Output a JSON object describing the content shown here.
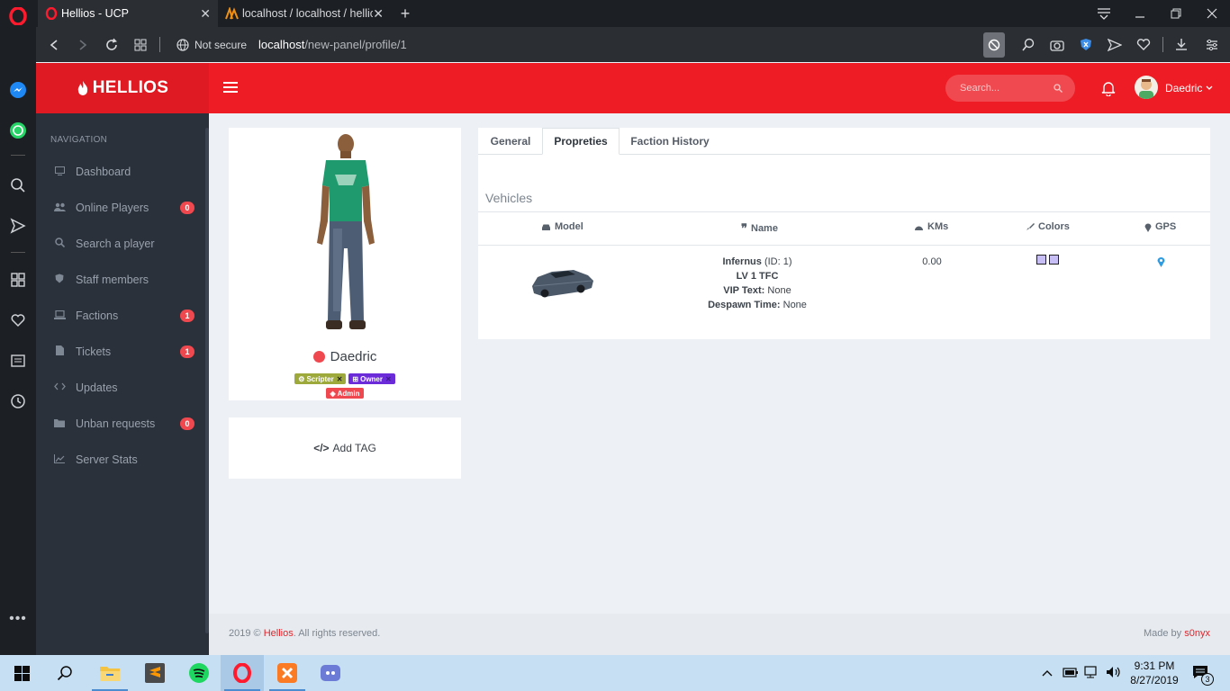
{
  "browser": {
    "tabs": [
      {
        "title": "Hellios - UCP",
        "active": true
      },
      {
        "title": "localhost / localhost / hellic",
        "active": false
      }
    ],
    "new_tab": "+",
    "security": "Not secure",
    "url_host": "localhost",
    "url_path": "/new-panel/profile/1"
  },
  "app": {
    "brand": "HELLIOS",
    "search_placeholder": "Search...",
    "user_name": "Daedric"
  },
  "sidebar": {
    "heading": "NAVIGATION",
    "items": [
      {
        "label": "Dashboard",
        "icon": "monitor-icon",
        "badge": ""
      },
      {
        "label": "Online Players",
        "icon": "users-icon",
        "badge": "0"
      },
      {
        "label": "Search a player",
        "icon": "search-icon",
        "badge": ""
      },
      {
        "label": "Staff members",
        "icon": "shield-icon",
        "badge": ""
      },
      {
        "label": "Factions",
        "icon": "laptop-icon",
        "badge": "1"
      },
      {
        "label": "Tickets",
        "icon": "file-icon",
        "badge": "1"
      },
      {
        "label": "Updates",
        "icon": "code-icon",
        "badge": ""
      },
      {
        "label": "Unban requests",
        "icon": "folder-icon",
        "badge": "0"
      },
      {
        "label": "Server Stats",
        "icon": "chart-icon",
        "badge": ""
      }
    ]
  },
  "profile": {
    "name": "Daedric",
    "status_color": "#f0484f",
    "tags": [
      {
        "label": "Scripter",
        "color": "#9ea93c"
      },
      {
        "label": "Owner",
        "color": "#6c2bd9"
      },
      {
        "label": "Admin",
        "color": "#f0484f"
      }
    ],
    "add_tag": "Add TAG"
  },
  "tabs": [
    {
      "label": "General",
      "active": false
    },
    {
      "label": "Propreties",
      "active": true
    },
    {
      "label": "Faction History",
      "active": false
    }
  ],
  "vehicles": {
    "title": "Vehicles",
    "columns": [
      "Model",
      "Name",
      "KMs",
      "Colors",
      "GPS"
    ],
    "rows": [
      {
        "name_bold": "Infernus",
        "name_id": "(ID: 1)",
        "plate": "LV 1 TFC",
        "vip_label": "VIP Text:",
        "vip_value": "None",
        "despawn_label": "Despawn Time:",
        "despawn_value": "None",
        "kms": "0.00",
        "colors": [
          "#c6bef5",
          "#c6bef5"
        ]
      }
    ]
  },
  "footer": {
    "copyright_prefix": "2019 ©",
    "brand": "Hellios",
    "rights": ". All rights reserved.",
    "made_by": "Made by",
    "author": "s0nyx"
  },
  "taskbar": {
    "time": "9:31 PM",
    "date": "8/27/2019",
    "notification_count": "3"
  },
  "colors": {
    "header_red": "#ee1c24",
    "sidebar_bg": "#2b313a",
    "badge_red": "#f0484f"
  }
}
